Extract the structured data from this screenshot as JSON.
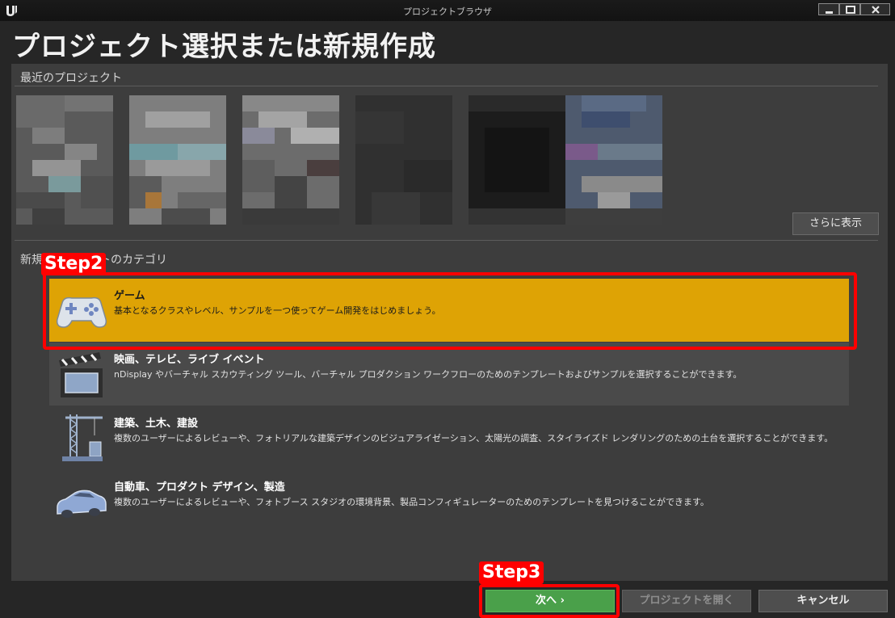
{
  "window": {
    "title": "プロジェクトブラウザ"
  },
  "page_title": "プロジェクト選択または新規作成",
  "recent": {
    "label": "最近のプロジェクト",
    "more_button": "さらに表示",
    "projects": [
      {
        "name": ""
      },
      {
        "name": ""
      },
      {
        "name": ""
      },
      {
        "name": ""
      },
      {
        "name": ""
      },
      {
        "name": ""
      }
    ]
  },
  "categories": {
    "label": "新規プロジェクトのカテゴリ",
    "items": [
      {
        "name": "ゲーム",
        "desc": "基本となるクラスやレベル、サンプルを一つ使ってゲーム開発をはじめましょう。",
        "icon": "gamepad-icon"
      },
      {
        "name": "映画、テレビ、ライブ イベント",
        "desc": "nDisplay やバーチャル スカウティング ツール、バーチャル プロダクション ワークフローのためのテンプレートおよびサンプルを選択することができます。",
        "icon": "clapperboard-icon"
      },
      {
        "name": "建築、土木、建設",
        "desc": "複数のユーザーによるレビューや、フォトリアルな建築デザインのビジュアライゼーション、太陽光の調査、スタイライズド レンダリングのための土台を選択することができます。",
        "icon": "crane-icon"
      },
      {
        "name": "自動車、プロダクト デザイン、製造",
        "desc": "複数のユーザーによるレビューや、フォトブース スタジオの環境背景、製品コンフィギュレーターのためのテンプレートを見つけることができます。",
        "icon": "car-icon"
      }
    ]
  },
  "annotations": {
    "step2": "Step2",
    "step3": "Step3"
  },
  "buttons": {
    "next": "次へ ›",
    "open": "プロジェクトを開く",
    "cancel": "キャンセル"
  },
  "colors": {
    "selected": "#dea305",
    "next_button": "#4aa04a",
    "annotation": "#ff0000"
  }
}
